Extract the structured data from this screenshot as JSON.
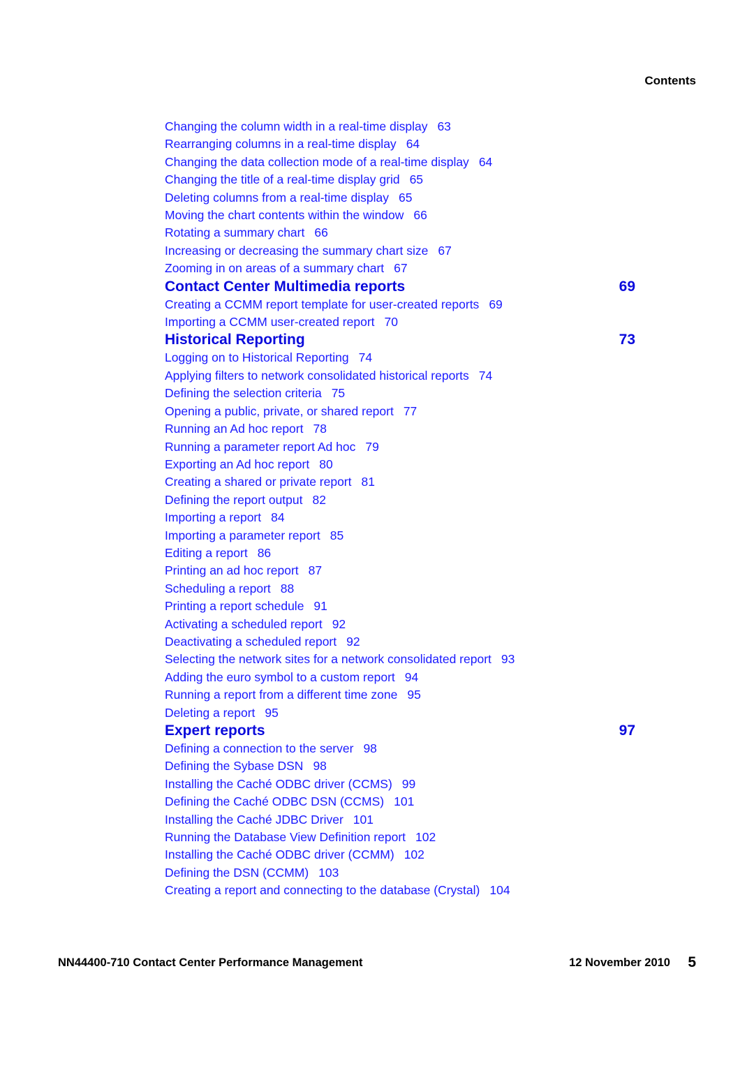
{
  "header": {
    "title": "Contents"
  },
  "toc": {
    "lead_entries": [
      {
        "title": "Changing the column width in a real-time display",
        "page": "63"
      },
      {
        "title": "Rearranging columns in a real-time display",
        "page": "64"
      },
      {
        "title": "Changing the data collection mode of a real-time display",
        "page": "64"
      },
      {
        "title": "Changing the title of a real-time display grid",
        "page": "65"
      },
      {
        "title": "Deleting columns from a real-time display",
        "page": "65"
      },
      {
        "title": "Moving the chart contents within the window",
        "page": "66"
      },
      {
        "title": "Rotating a summary chart",
        "page": "66"
      },
      {
        "title": "Increasing or decreasing the summary chart size",
        "page": "67"
      },
      {
        "title": "Zooming in on areas of a summary chart",
        "page": "67"
      }
    ],
    "sections": [
      {
        "title": "Contact Center Multimedia reports",
        "page": "69",
        "entries": [
          {
            "title": "Creating a CCMM report template for user-created reports",
            "page": "69"
          },
          {
            "title": "Importing a CCMM user-created report",
            "page": "70"
          }
        ]
      },
      {
        "title": "Historical Reporting",
        "page": "73",
        "entries": [
          {
            "title": "Logging on to Historical Reporting",
            "page": "74"
          },
          {
            "title": "Applying filters to network consolidated historical reports",
            "page": "74"
          },
          {
            "title": "Defining the selection criteria",
            "page": "75"
          },
          {
            "title": "Opening a public, private, or shared report",
            "page": "77"
          },
          {
            "title": "Running an Ad hoc report",
            "page": "78"
          },
          {
            "title": "Running a parameter report Ad hoc",
            "page": "79"
          },
          {
            "title": "Exporting an Ad hoc report",
            "page": "80"
          },
          {
            "title": "Creating a shared or private report",
            "page": "81"
          },
          {
            "title": "Defining the report output",
            "page": "82"
          },
          {
            "title": "Importing a report",
            "page": "84"
          },
          {
            "title": "Importing a parameter report",
            "page": "85"
          },
          {
            "title": "Editing a report",
            "page": "86"
          },
          {
            "title": "Printing an ad hoc report",
            "page": "87"
          },
          {
            "title": "Scheduling a report",
            "page": "88"
          },
          {
            "title": "Printing a report schedule",
            "page": "91"
          },
          {
            "title": "Activating a scheduled report",
            "page": "92"
          },
          {
            "title": "Deactivating a scheduled report",
            "page": "92"
          },
          {
            "title": "Selecting the network sites for a network consolidated report",
            "page": "93"
          },
          {
            "title": "Adding the euro symbol to a custom report",
            "page": "94"
          },
          {
            "title": "Running a report from a different time zone",
            "page": "95"
          },
          {
            "title": "Deleting a report",
            "page": "95"
          }
        ]
      },
      {
        "title": "Expert reports",
        "page": "97",
        "entries": [
          {
            "title": "Defining a connection to the server",
            "page": "98"
          },
          {
            "title": "Defining the Sybase DSN",
            "page": "98"
          },
          {
            "title": "Installing the Caché ODBC driver (CCMS)",
            "page": "99"
          },
          {
            "title": "Defining the Caché ODBC DSN (CCMS)",
            "page": "101"
          },
          {
            "title": "Installing the Caché JDBC Driver",
            "page": "101"
          },
          {
            "title": "Running the Database View Definition report",
            "page": "102"
          },
          {
            "title": "Installing the Caché ODBC driver (CCMM)",
            "page": "102"
          },
          {
            "title": "Defining the DSN (CCMM)",
            "page": "103"
          },
          {
            "title": "Creating a report and connecting to the database (Crystal)",
            "page": "104"
          }
        ]
      }
    ]
  },
  "footer": {
    "document": "NN44400-710 Contact Center Performance Management",
    "date": "12 November 2010",
    "page_number": "5"
  },
  "colors": {
    "link": "#1a1aff",
    "section": "#0a0adc",
    "text": "#000000"
  }
}
